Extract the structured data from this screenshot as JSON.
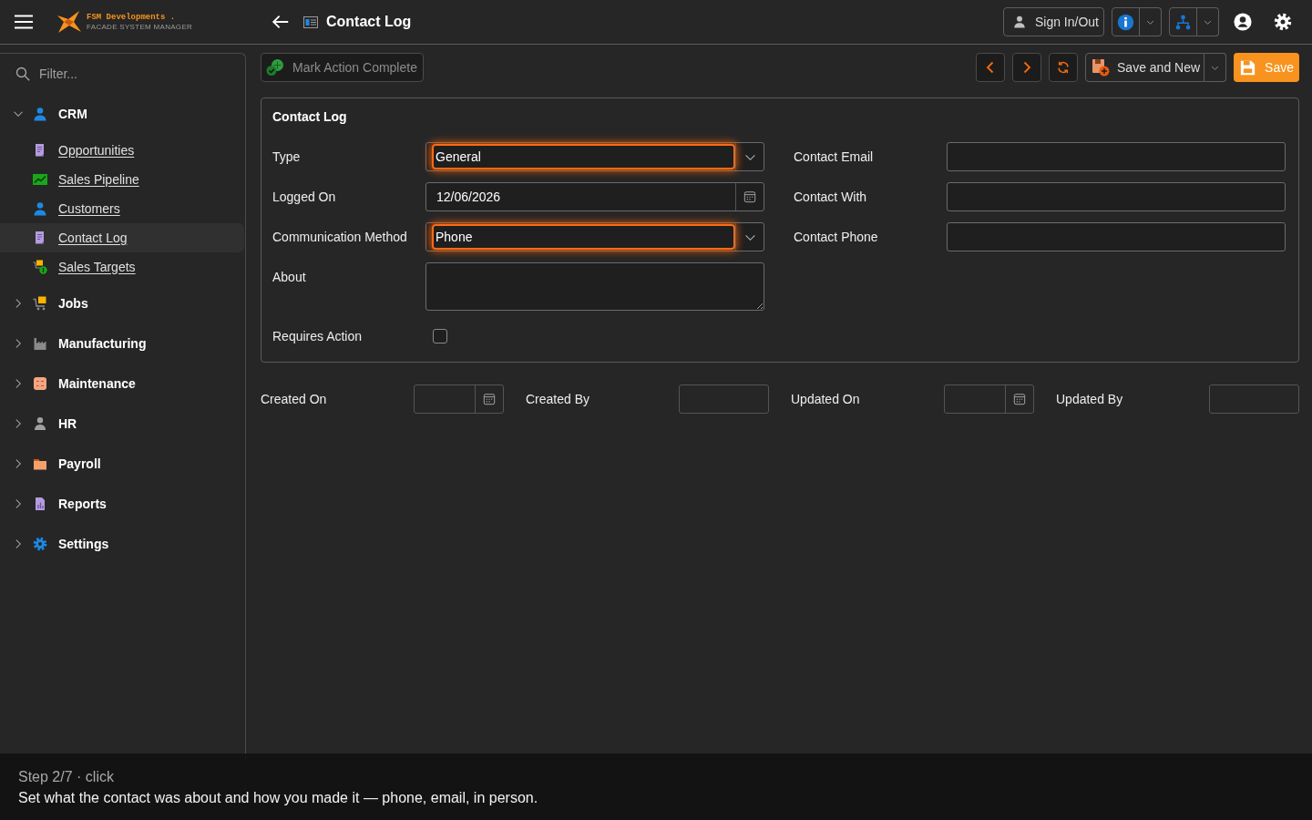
{
  "header": {
    "logo": {
      "name": "FSM Developments .",
      "tagline": "FACADE SYSTEM MANAGER"
    },
    "page_title": "Contact Log",
    "sign_in_button": "Sign In/Out"
  },
  "sidebar": {
    "filter": {
      "placeholder": "Filter..."
    },
    "items": [
      {
        "label": "CRM",
        "expanded": true,
        "children": [
          {
            "label": "Opportunities",
            "selected": false
          },
          {
            "label": "Sales Pipeline",
            "selected": false
          },
          {
            "label": "Customers",
            "selected": false
          },
          {
            "label": "Contact Log",
            "selected": true
          },
          {
            "label": "Sales Targets",
            "selected": false
          }
        ]
      },
      {
        "label": "Jobs",
        "expanded": false
      },
      {
        "label": "Manufacturing",
        "expanded": false
      },
      {
        "label": "Maintenance",
        "expanded": false
      },
      {
        "label": "HR",
        "expanded": false
      },
      {
        "label": "Payroll",
        "expanded": false
      },
      {
        "label": "Reports",
        "expanded": false
      },
      {
        "label": "Settings",
        "expanded": false
      }
    ]
  },
  "toolbar": {
    "mark_action_button": {
      "label": "Mark Action Complete",
      "disabled": true
    },
    "save_and_new_button": "Save and New",
    "save_button": "Save"
  },
  "form": {
    "title": "Contact Log",
    "left_fields": [
      {
        "kind": "select",
        "label": "Type",
        "value": "General",
        "highlighted": true
      },
      {
        "kind": "date",
        "label": "Logged On",
        "value": "12/06/2026"
      },
      {
        "kind": "select",
        "label": "Communication Method",
        "value": "Phone",
        "highlighted": true
      },
      {
        "kind": "textarea",
        "label": "About"
      },
      {
        "kind": "checkbox",
        "label": "Requires Action",
        "checked": false
      }
    ],
    "right_fields": [
      {
        "kind": "text",
        "label": "Contact Email"
      },
      {
        "kind": "text",
        "label": "Contact With"
      },
      {
        "kind": "text",
        "label": "Contact Phone"
      }
    ]
  },
  "audit_fields": [
    {
      "kind": "date",
      "label": "Created On"
    },
    {
      "kind": "text",
      "label": "Created By"
    },
    {
      "kind": "date",
      "label": "Updated On"
    },
    {
      "kind": "text",
      "label": "Updated By"
    }
  ],
  "tutorial": {
    "step": "Step 2/7 · click",
    "instruction": "Set what the contact was about and how you made it — phone, email, in person."
  }
}
